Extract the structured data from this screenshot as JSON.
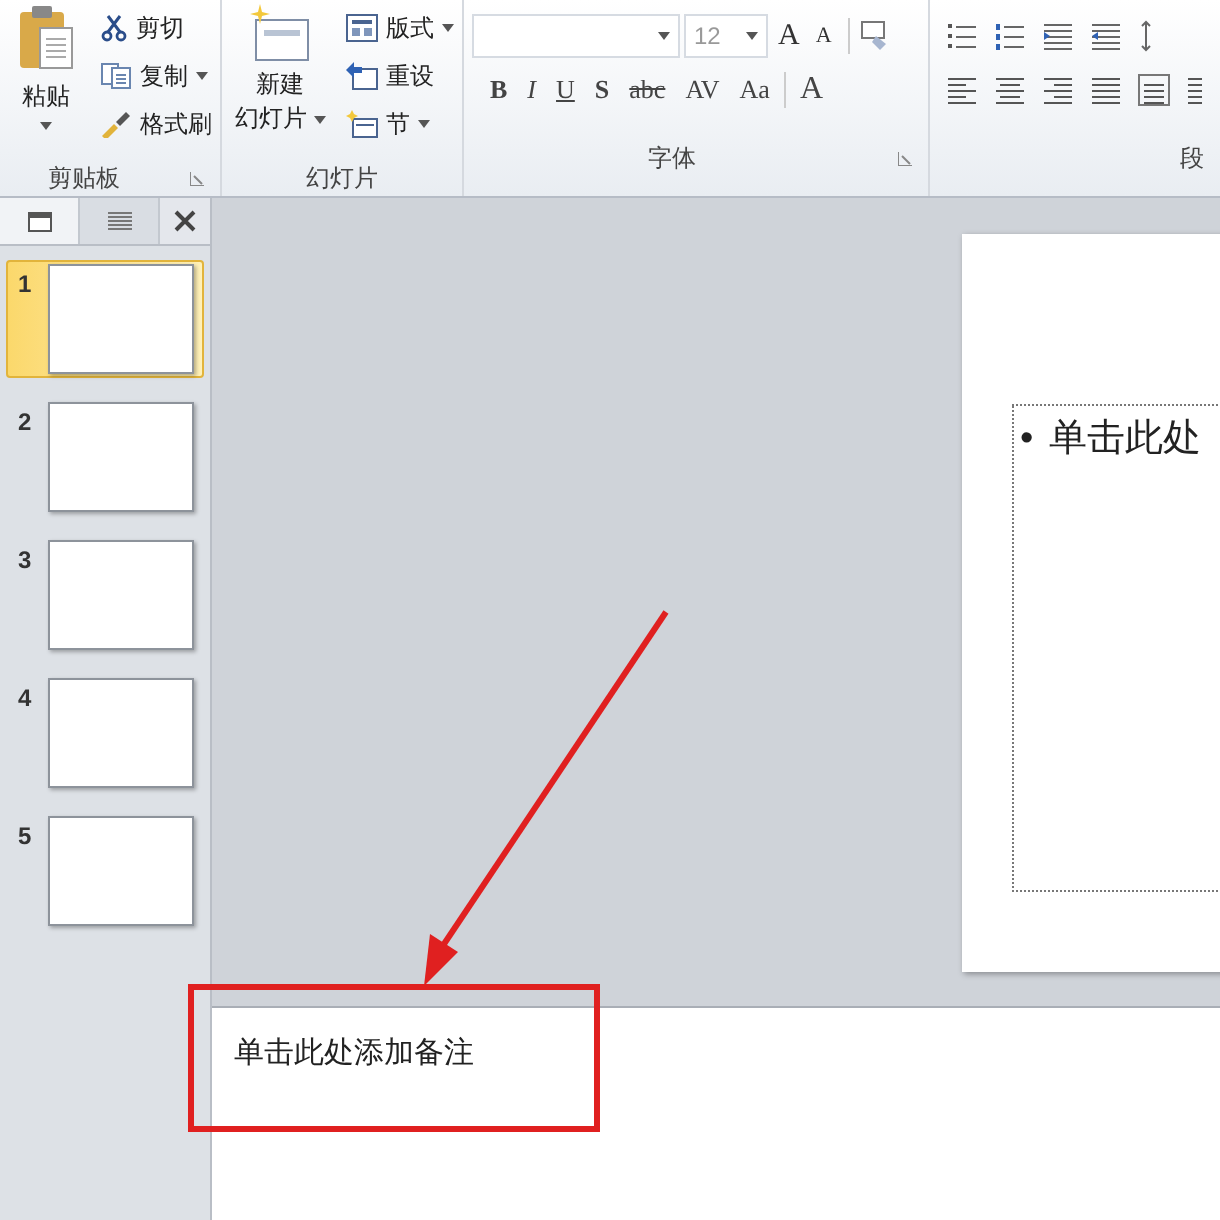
{
  "clipboard": {
    "paste": "粘贴",
    "cut": "剪切",
    "copy": "复制",
    "format_painter": "格式刷",
    "label": "剪贴板"
  },
  "slides_group": {
    "new_slide": [
      "新建",
      "幻灯片"
    ],
    "layout": "版式",
    "reset": "重设",
    "section": "节",
    "label": "幻灯片"
  },
  "font": {
    "size": "12",
    "size_buttons": [
      {
        "kind": "grow",
        "label": "A"
      },
      {
        "kind": "shrink",
        "label": "A"
      }
    ],
    "format_buttons": [
      {
        "kind": "bold",
        "label": "B"
      },
      {
        "kind": "italic",
        "label": "I"
      },
      {
        "kind": "underline",
        "label": "U"
      },
      {
        "kind": "shadow",
        "label": "S"
      },
      {
        "kind": "strike",
        "label": "abc"
      },
      {
        "kind": "spacing",
        "label": "AV"
      },
      {
        "kind": "case",
        "label": "Aa"
      },
      {
        "kind": "color",
        "label": "A"
      }
    ],
    "label": "字体"
  },
  "paragraph": {
    "label": "段"
  },
  "panel_tabs": [
    {
      "kind": "slides",
      "selected": true
    },
    {
      "kind": "outline",
      "selected": false
    }
  ],
  "slides": [
    {
      "number": "1",
      "selected": true
    },
    {
      "number": "2",
      "selected": false
    },
    {
      "number": "3",
      "selected": false
    },
    {
      "number": "4",
      "selected": false
    },
    {
      "number": "5",
      "selected": false
    }
  ],
  "slide": {
    "bullet": "•",
    "text": "单击此处"
  },
  "notes": {
    "placeholder": "单击此处添加备注"
  }
}
